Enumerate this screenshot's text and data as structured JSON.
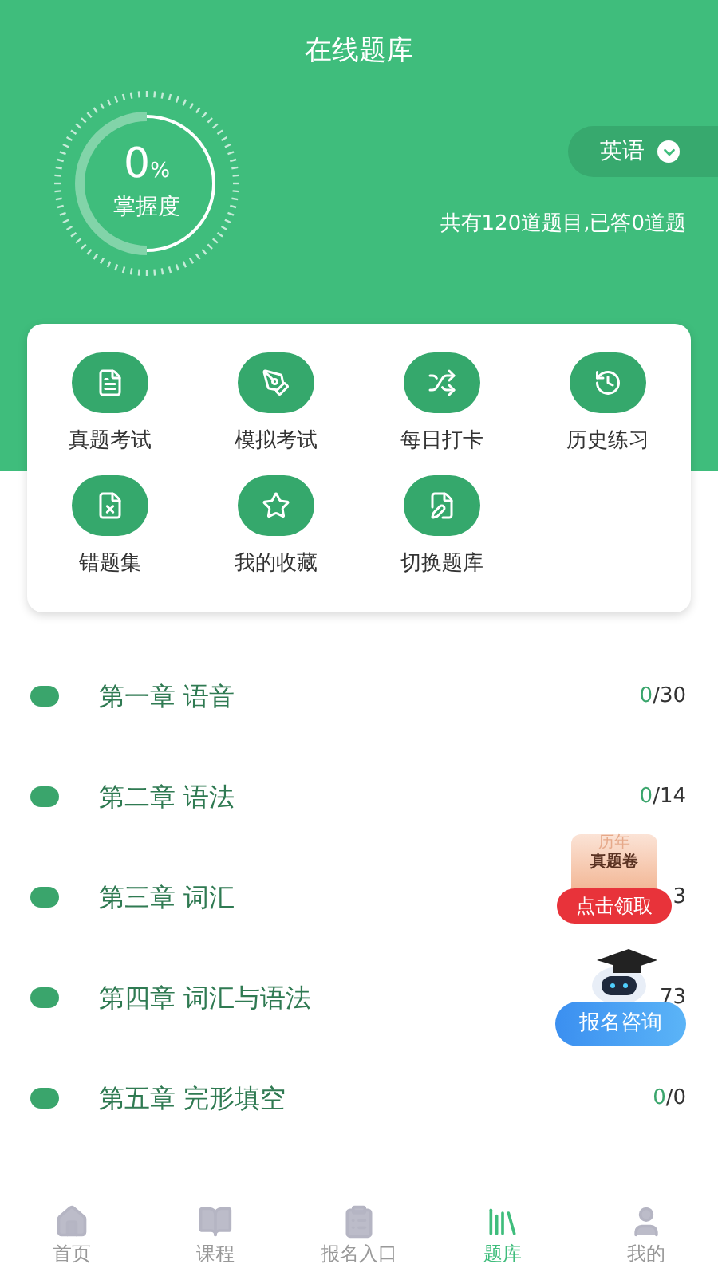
{
  "header": {
    "title": "在线题库"
  },
  "mastery": {
    "value": "0",
    "unit": "%",
    "label": "掌握度"
  },
  "subject": {
    "label": "英语"
  },
  "summary": "共有120道题目,已答0道题",
  "shortcuts": [
    {
      "label": "真题考试",
      "kind": "doc"
    },
    {
      "label": "模拟考试",
      "kind": "pen"
    },
    {
      "label": "每日打卡",
      "kind": "shuffle"
    },
    {
      "label": "历史练习",
      "kind": "history"
    },
    {
      "label": "错题集",
      "kind": "wrong"
    },
    {
      "label": "我的收藏",
      "kind": "star"
    },
    {
      "label": "切换题库",
      "kind": "edit"
    }
  ],
  "chapters": [
    {
      "title": "第一章 语音",
      "answered": "0",
      "total": "/30"
    },
    {
      "title": "第二章 语法",
      "answered": "0",
      "total": "/14"
    },
    {
      "title": "第三章 词汇",
      "total": "3"
    },
    {
      "title": "第四章 词汇与语法",
      "total": "73"
    },
    {
      "title": "第五章 完形填空",
      "answered": "0",
      "total": "/0"
    }
  ],
  "promo": {
    "top": "历年",
    "title": "真题卷",
    "button": "点击领取"
  },
  "consult": {
    "button": "报名咨询"
  },
  "tabs": [
    {
      "label": "首页",
      "selected": false
    },
    {
      "label": "课程",
      "selected": false
    },
    {
      "label": "报名入口",
      "selected": false
    },
    {
      "label": "题库",
      "selected": true
    },
    {
      "label": "我的",
      "selected": false
    }
  ]
}
